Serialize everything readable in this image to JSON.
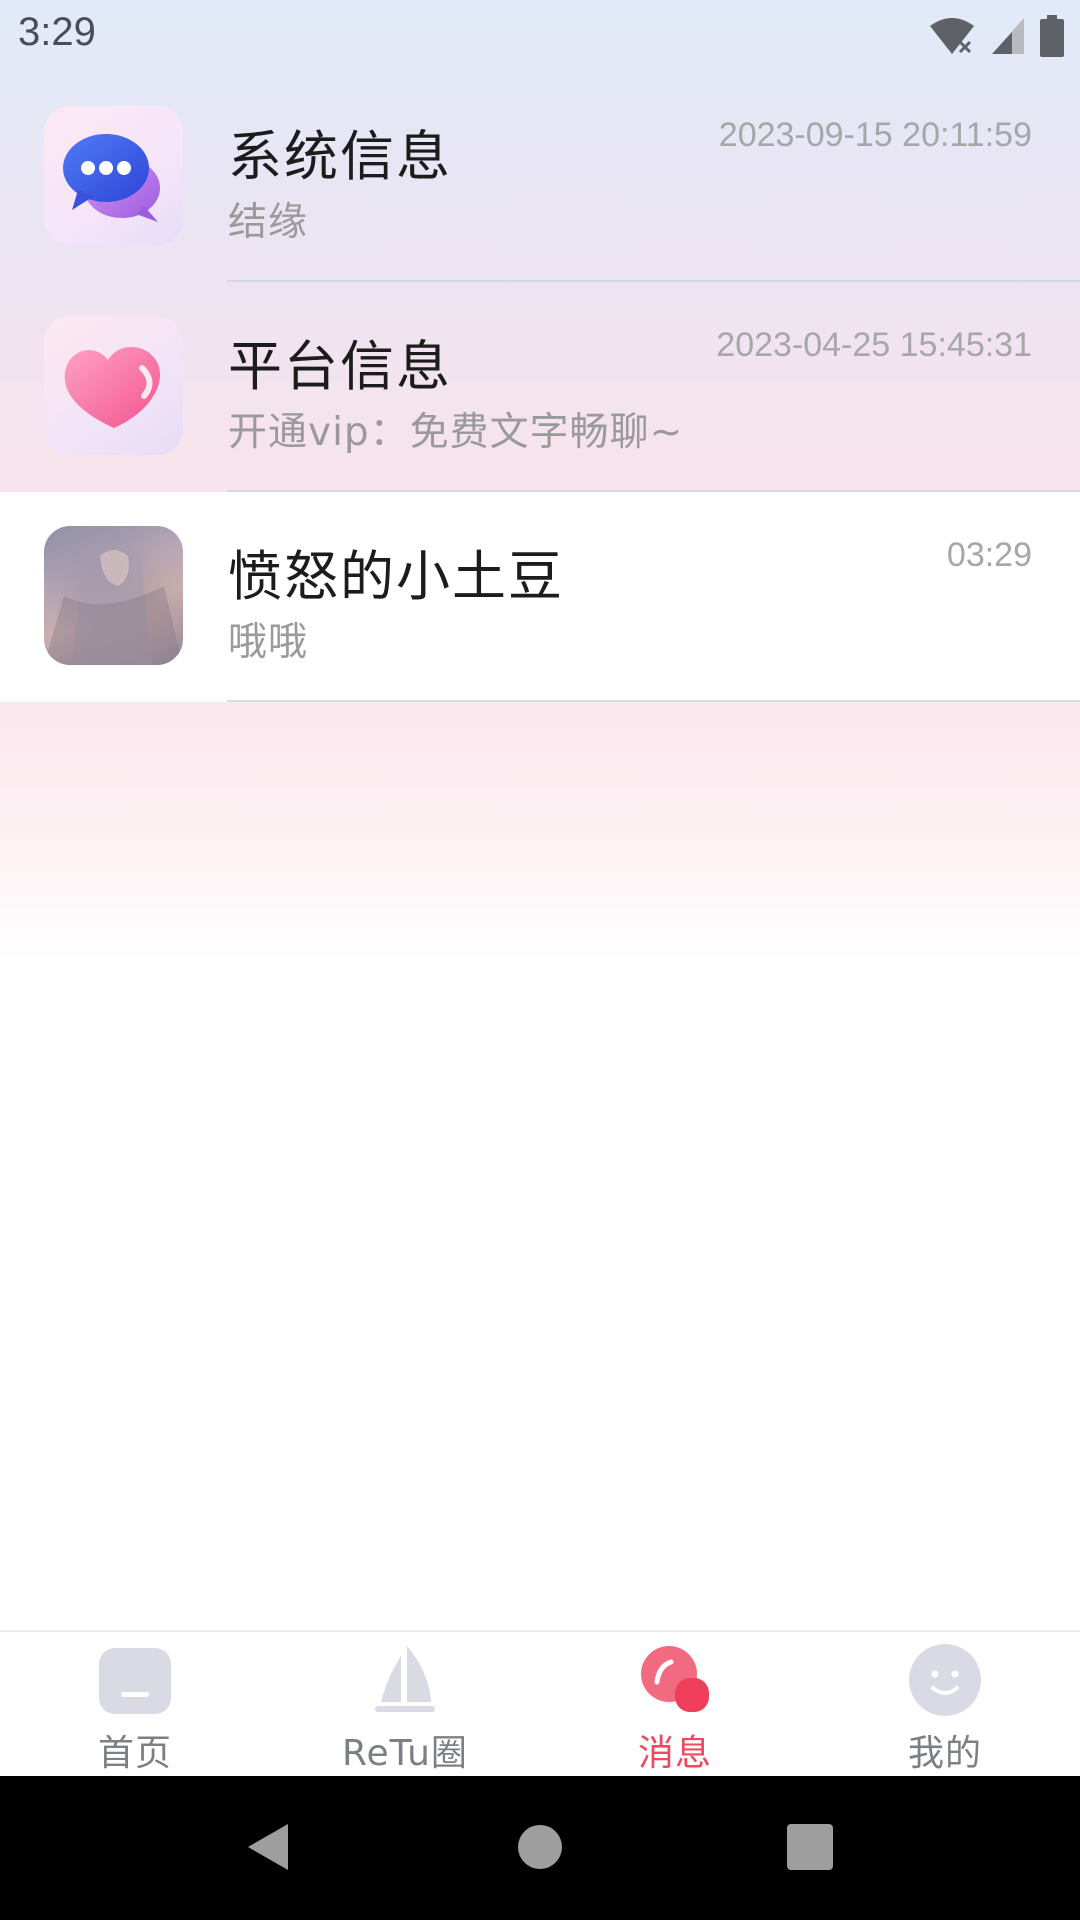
{
  "status_bar": {
    "time": "3:29",
    "icons": [
      "wifi-icon",
      "signal-icon",
      "battery-icon"
    ]
  },
  "messages": [
    {
      "title": "系统信息",
      "subtitle": "结缘",
      "time": "2023-09-15 20:11:59",
      "avatar_icon": "chat-bubble-icon"
    },
    {
      "title": "平台信息",
      "subtitle": "开通vip：免费文字畅聊~",
      "time": "2023-04-25 15:45:31",
      "avatar_icon": "heart-icon"
    },
    {
      "title": "愤怒的小土豆",
      "subtitle": "哦哦",
      "time": "03:29",
      "avatar_icon": "user-photo"
    }
  ],
  "tabs": [
    {
      "label": "首页",
      "icon": "home-icon",
      "active": false
    },
    {
      "label": "ReTu圈",
      "icon": "sail-icon",
      "active": false
    },
    {
      "label": "消息",
      "icon": "message-icon",
      "active": true
    },
    {
      "label": "我的",
      "icon": "smile-icon",
      "active": false
    }
  ],
  "nav_bar": {
    "buttons": [
      "back-icon",
      "home-circle-icon",
      "recents-icon"
    ]
  },
  "colors": {
    "accent": "#f0485f",
    "tab_inactive": "#7d7f86",
    "title_text": "#1c1c1c",
    "sub_text": "#9a9a9a"
  }
}
